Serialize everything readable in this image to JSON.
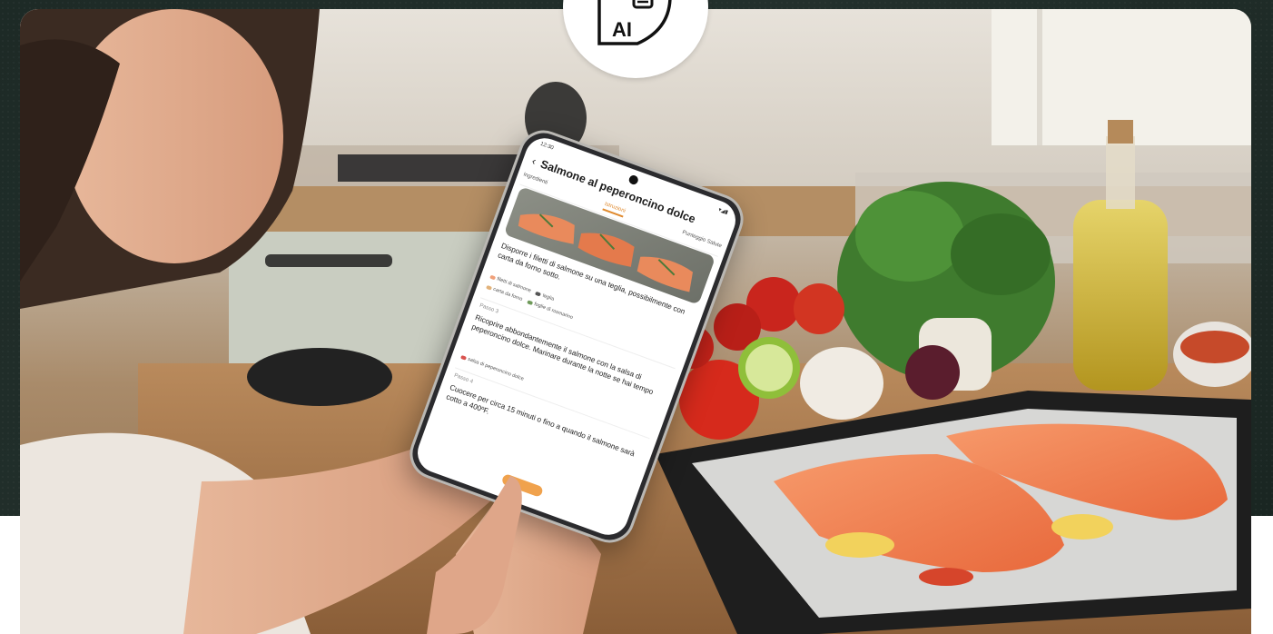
{
  "badge": {
    "label": "AI",
    "icon": "ai-recipe-icon"
  },
  "phone": {
    "status_time": "12:30",
    "status_icons": "▾◢▮",
    "app": {
      "title": "Salmone al peperoncino dolce",
      "back_icon": "‹",
      "tabs": [
        {
          "label": "Ingredienti",
          "active": false
        },
        {
          "label": "Istruzioni",
          "active": true
        },
        {
          "label": "Punteggio Salute",
          "active": false
        }
      ],
      "steps": [
        {
          "label": "",
          "text": "Disporre i filetti di salmone su una teglia, possibilmente con carta da forno sotto.",
          "chips": [
            {
              "label": "filetti di salmone",
              "color": "#f0a07a"
            },
            {
              "label": "teglia",
              "color": "#555555"
            },
            {
              "label": "carta da forno",
              "color": "#e2b27a"
            },
            {
              "label": "foglie di rosmarino",
              "color": "#6f9a5a"
            }
          ]
        },
        {
          "label": "Passo 3",
          "text": "Ricoprire abbondantemente il salmone con la salsa di peperoncino dolce. Marinare durante la notte se hai tempo",
          "chips": [
            {
              "label": "salsa di peperoncino dolce",
              "color": "#d9534f"
            }
          ]
        },
        {
          "label": "Passo 4",
          "text": "Cuocere per circa 15 minuti o fino a quando il salmone sarà cotto a 400ºF.",
          "chips": []
        }
      ]
    }
  },
  "colors": {
    "accent": "#e08a2e",
    "band": "#1d2a26"
  }
}
